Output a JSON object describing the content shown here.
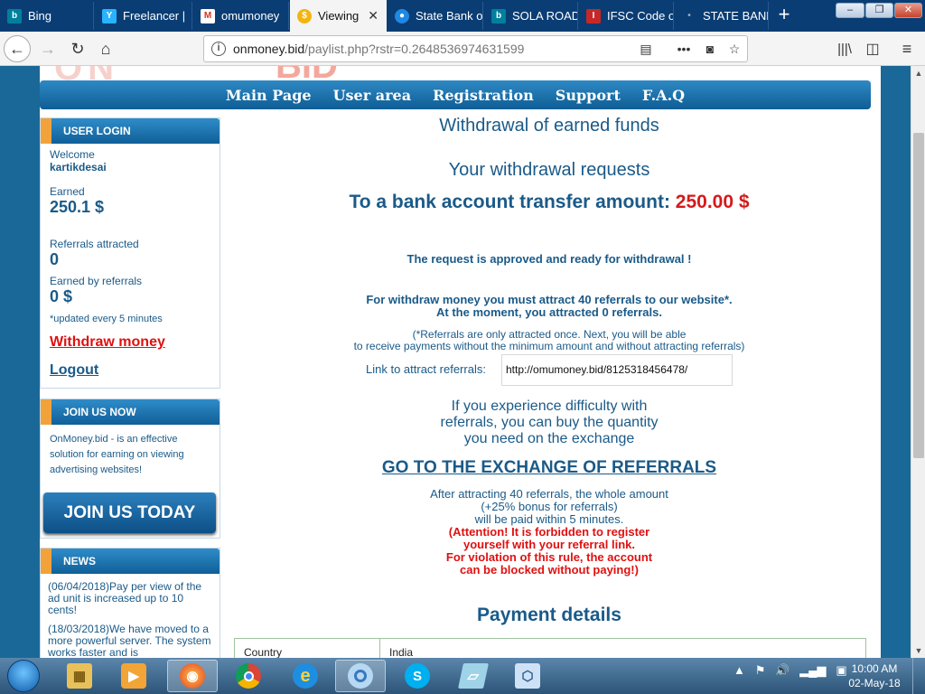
{
  "browser": {
    "tabs": [
      {
        "title": "Bing",
        "fav_color": "#00809d",
        "fav_glyph": "b"
      },
      {
        "title": "Freelancer |",
        "fav_color": "#29b2fe",
        "fav_glyph": "Y"
      },
      {
        "title": "omumoney",
        "fav_color": "#ffffff",
        "fav_glyph": "M"
      },
      {
        "title": "Viewing",
        "fav_color": "#f2b50f",
        "fav_glyph": "$"
      },
      {
        "title": "State Bank o",
        "fav_color": "#1e88e5",
        "fav_glyph": "●"
      },
      {
        "title": "SOLA ROAD",
        "fav_color": "#00809d",
        "fav_glyph": "b"
      },
      {
        "title": "IFSC Code o",
        "fav_color": "#c62828",
        "fav_glyph": "I"
      },
      {
        "title": "STATE BANK",
        "fav_color": "#3d2a8a",
        "fav_glyph": "•"
      }
    ],
    "url_host": "onmoney.bid",
    "url_path": "/paylist.php?rstr=0.2648536974631599"
  },
  "page": {
    "logo_text": "ON",
    "logo_text2": "BID",
    "menu": [
      "Main Page",
      "User area",
      "Registration",
      "Support",
      "F.A.Q"
    ],
    "sidebar": {
      "login_head": "USER LOGIN",
      "welcome": "Welcome",
      "username": "kartikdesai",
      "earned_label": "Earned",
      "earned_value": "250.1 $",
      "referrals_label": "Referrals attracted",
      "referrals_value": "0",
      "earned_ref_label": "Earned by referrals",
      "earned_ref_value": "0 $",
      "updated_note": "*updated every 5 minutes",
      "withdraw_link": "Withdraw money",
      "logout_link": "Logout",
      "join_head": "JOIN US NOW",
      "join_text": "OnMoney.bid - is an effective solution for earning on viewing advertising websites!",
      "join_button": "JOIN US TODAY",
      "news_head": "NEWS",
      "news": [
        "(06/04/2018)Pay per view of the ad unit is increased up to 10 cents!",
        "(18/03/2018)We have moved to a more powerful server. The system works faster and is"
      ]
    },
    "main": {
      "title": "Withdrawal of earned funds",
      "requests_title": "Your withdrawal requests",
      "amount_label": "To a bank account transfer amount:",
      "amount_value": "250.00 $",
      "approved": "The request is approved and ready for withdrawal !",
      "attract_line1": "For withdraw money you must attract 40 referrals to our website*.",
      "attract_line2": "At the moment, you attracted 0 referrals.",
      "note_line1": "(*Referrals are only attracted once. Next, you will be able",
      "note_line2": "to receive payments without the minimum amount and without attracting referrals)",
      "link_label": "Link to attract referrals:",
      "ref_link": "http://omumoney.bid/8125318456478/",
      "difficulty_1": "If you experience difficulty with",
      "difficulty_2": "referrals, you can buy the quantity",
      "difficulty_3": "you need on the exchange",
      "exchange_link": "GO TO THE EXCHANGE OF REFERRALS",
      "after_1": "After attracting 40 referrals, the whole amount",
      "after_2": "(+25% bonus for referrals)",
      "after_3": "will be paid within 5 minutes.",
      "attention_1": "(Attention! It is forbidden to register",
      "attention_2": "yourself with your referral link.",
      "attention_3": "For violation of this rule, the account",
      "attention_4": "can be blocked without paying!)",
      "payment_title": "Payment details",
      "payment_rows": [
        {
          "key": "Country",
          "value": "India"
        }
      ]
    }
  },
  "taskbar": {
    "time": "10:00 AM",
    "date": "02-May-18"
  }
}
